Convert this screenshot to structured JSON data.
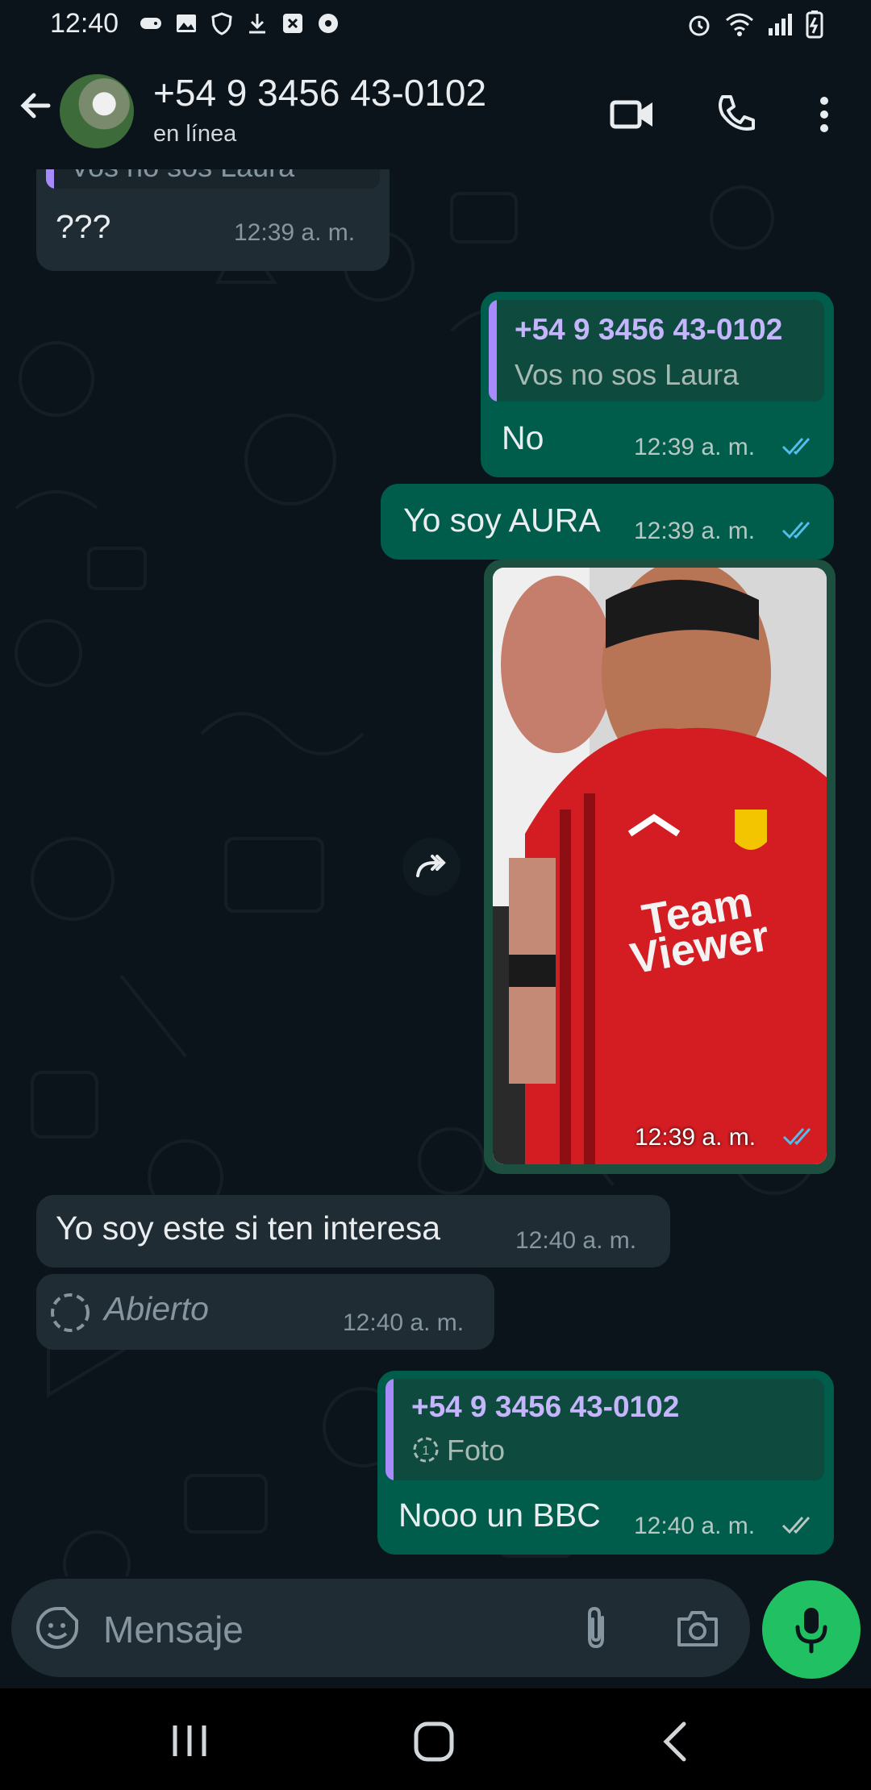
{
  "status_bar": {
    "time": "12:40",
    "notification_icons": [
      "gamepad-icon",
      "gallery-icon",
      "shield-icon",
      "download-icon",
      "close-box-icon",
      "soccer-ball-icon"
    ],
    "system_icons": [
      "alarm-icon",
      "wifi-icon",
      "signal-icon",
      "battery-icon"
    ]
  },
  "header": {
    "contact_name": "+54 9 3456 43-0102",
    "contact_status": "en línea"
  },
  "messages": [
    {
      "side": "in",
      "partial_quote_text": "Vos no sos Laura",
      "text": "???",
      "time": "12:39 a. m."
    },
    {
      "side": "out",
      "quote": {
        "name": "+54 9 3456 43-0102",
        "text": "Vos no sos Laura"
      },
      "text": "No",
      "time": "12:39 a. m.",
      "status": "read"
    },
    {
      "side": "out",
      "text": "Yo soy AURA",
      "time": "12:39 a. m.",
      "status": "read"
    },
    {
      "side": "out",
      "type": "image",
      "image_text": [
        "Team",
        "Viewer"
      ],
      "time": "12:39 a. m.",
      "status": "read"
    },
    {
      "side": "in",
      "text": "Yo soy este si ten interesa",
      "time": "12:40 a. m."
    },
    {
      "side": "in",
      "type": "view-once",
      "text": "Abierto",
      "time": "12:40 a. m."
    },
    {
      "side": "out",
      "quote": {
        "name": "+54 9 3456 43-0102",
        "text": "Foto"
      },
      "text": "Nooo un BBC",
      "time": "12:40 a. m.",
      "status": "delivered"
    }
  ],
  "composer": {
    "placeholder": "Mensaje"
  },
  "colors": {
    "background": "#0b141a",
    "incoming_bubble": "#202c33",
    "outgoing_bubble": "#005c4b",
    "quote_accent": "#a78bfa",
    "read_ticks": "#53bdeb",
    "mic_button": "#21c063"
  }
}
